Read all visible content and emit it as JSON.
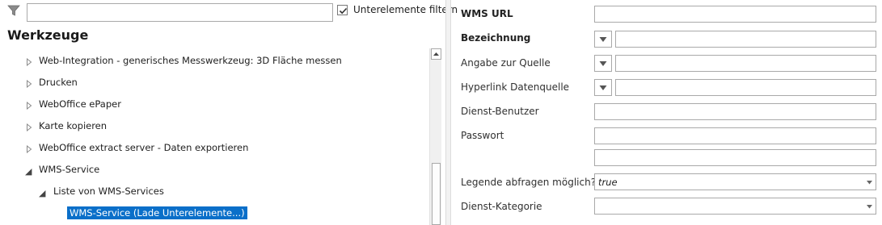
{
  "filter": {
    "input_value": "",
    "checkbox_label": "Unterelemente filtern",
    "checkbox_checked": true
  },
  "panel": {
    "title": "Werkzeuge"
  },
  "tree": {
    "items": [
      {
        "label": "Web-Integration - generisches Messwerkzeug: 3D Fläche messen",
        "expanded": false,
        "level": 0
      },
      {
        "label": "Drucken",
        "expanded": false,
        "level": 0
      },
      {
        "label": "WebOffice ePaper",
        "expanded": false,
        "level": 0
      },
      {
        "label": "Karte kopieren",
        "expanded": false,
        "level": 0
      },
      {
        "label": "WebOffice extract server - Daten exportieren",
        "expanded": false,
        "level": 0
      },
      {
        "label": "WMS-Service",
        "expanded": true,
        "level": 0
      },
      {
        "label": "Liste von WMS-Services",
        "expanded": true,
        "level": 1
      },
      {
        "label": "WMS-Service (Lade Unterelemente...)",
        "selected": true,
        "level": 2
      }
    ]
  },
  "form": {
    "fields": [
      {
        "label": "WMS URL",
        "value": ""
      },
      {
        "label": "Bezeichnung",
        "value": ""
      },
      {
        "label": "Angabe zur Quelle",
        "value": ""
      },
      {
        "label": "Hyperlink Datenquelle",
        "value": ""
      },
      {
        "label": "Dienst-Benutzer",
        "value": ""
      },
      {
        "label": "Passwort",
        "value": "",
        "confirm_value": ""
      },
      {
        "label": "Legende abfragen möglich?",
        "value": "true"
      },
      {
        "label": "Dienst-Kategorie",
        "value": ""
      }
    ]
  },
  "colors": {
    "selection": "#0a6fc9",
    "border": "#a9a9a9",
    "divider": "#f2f2f2"
  },
  "icons": [
    "filter-icon",
    "checkmark-icon",
    "expand-arrow-icon",
    "collapse-arrow-icon",
    "dropdown-arrow-icon",
    "scroll-up-icon"
  ]
}
